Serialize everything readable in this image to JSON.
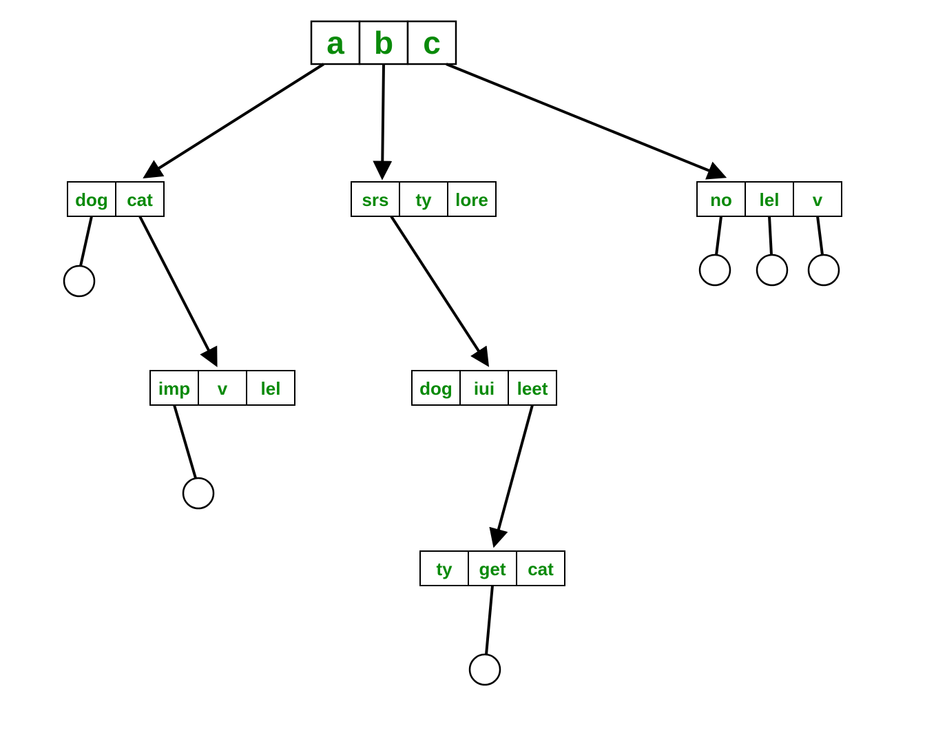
{
  "diagram": {
    "type": "tree",
    "colors": {
      "text": "#0a8a0a",
      "stroke": "#000000",
      "fill": "#ffffff"
    },
    "root": {
      "cells": [
        "a",
        "b",
        "c"
      ],
      "children": [
        {
          "from_cell": 0,
          "cells": [
            "dog",
            "cat"
          ],
          "children": [
            {
              "from_cell": 0,
              "leaf": true
            },
            {
              "from_cell": 1,
              "cells": [
                "imp",
                "v",
                "lel"
              ],
              "children": [
                {
                  "from_cell": 0,
                  "leaf": true
                }
              ]
            }
          ]
        },
        {
          "from_cell": 1,
          "cells": [
            "srs",
            "ty",
            "lore"
          ],
          "children": [
            {
              "from_cell": 0,
              "cells": [
                "dog",
                "iui",
                "leet"
              ],
              "children": [
                {
                  "from_cell": 2,
                  "cells": [
                    "ty",
                    "get",
                    "cat"
                  ],
                  "children": [
                    {
                      "from_cell": 1,
                      "leaf": true
                    }
                  ]
                }
              ]
            }
          ]
        },
        {
          "from_cell": 2,
          "cells": [
            "no",
            "lel",
            "v"
          ],
          "children": [
            {
              "from_cell": 0,
              "leaf": true
            },
            {
              "from_cell": 1,
              "leaf": true
            },
            {
              "from_cell": 2,
              "leaf": true
            }
          ]
        }
      ]
    }
  }
}
